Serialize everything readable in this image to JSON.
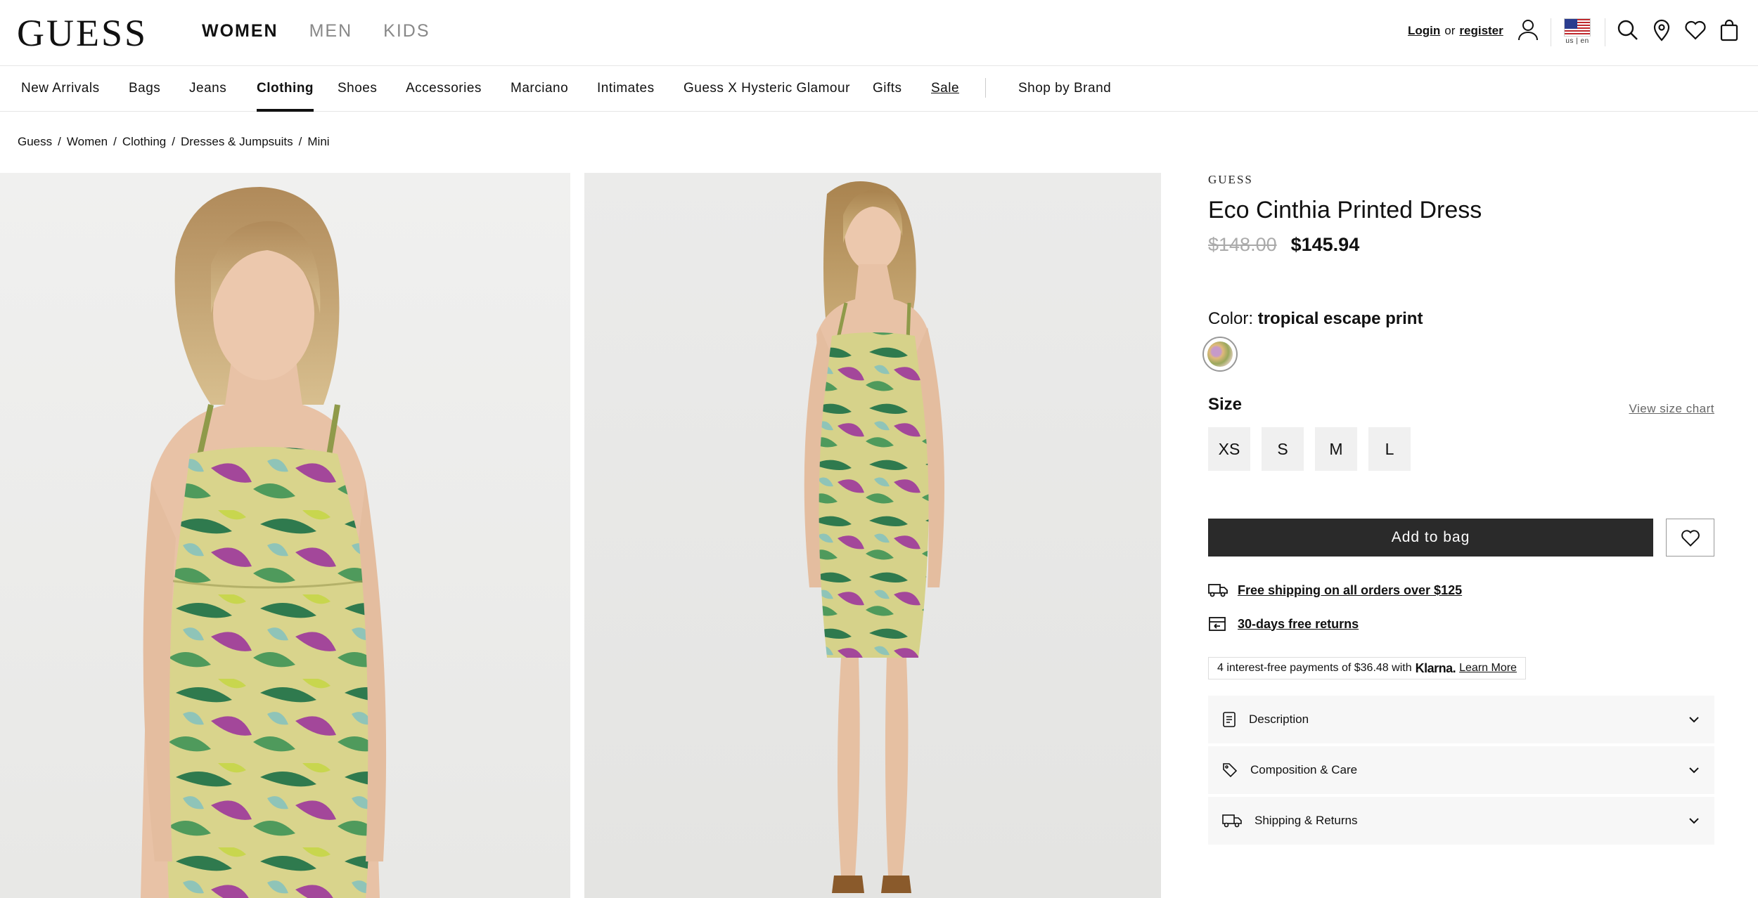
{
  "header": {
    "logo": "GUESS",
    "gender_tabs": [
      {
        "label": "WOMEN",
        "active": true
      },
      {
        "label": "MEN",
        "active": false
      },
      {
        "label": "KIDS",
        "active": false
      }
    ],
    "login_label": "Login",
    "or_label": "or",
    "register_label": "register",
    "locale_label": "us | en"
  },
  "categories": [
    {
      "label": "New Arrivals"
    },
    {
      "label": "Bags"
    },
    {
      "label": "Jeans"
    },
    {
      "label": "Clothing"
    },
    {
      "label": "Shoes"
    },
    {
      "label": "Accessories"
    },
    {
      "label": "Marciano"
    },
    {
      "label": "Intimates"
    },
    {
      "label": "Guess X Hysteric Glamour"
    },
    {
      "label": "Gifts"
    },
    {
      "label": "Sale"
    },
    {
      "label": "Shop by Brand"
    }
  ],
  "active_category": "Clothing",
  "breadcrumb": [
    "Guess",
    "Women",
    "Clothing",
    "Dresses & Jumpsuits",
    "Mini"
  ],
  "product": {
    "brand": "GUESS",
    "title": "Eco Cinthia Printed Dress",
    "original_price": "$148.00",
    "sale_price": "$145.94",
    "color_prefix": "Color:",
    "color_name": "tropical escape print",
    "size_label": "Size",
    "size_chart_label": "View size chart",
    "sizes": [
      "XS",
      "S",
      "M",
      "L"
    ],
    "add_to_bag_label": "Add to bag"
  },
  "perks": {
    "shipping": "Free shipping on all orders over $125",
    "returns": "30-days free returns"
  },
  "klarna": {
    "text": "4 interest-free payments of $36.48 with",
    "brand": "Klarna.",
    "learn_more": "Learn More"
  },
  "accordions": [
    {
      "label": "Description"
    },
    {
      "label": "Composition & Care"
    },
    {
      "label": "Shipping & Returns"
    }
  ],
  "colors": {
    "text": "#111111",
    "muted": "#888888",
    "button_dark": "#2a2a2a",
    "size_bg": "#f0f0f0"
  },
  "icons": [
    "user-icon",
    "flag-us-icon",
    "search-icon",
    "location-pin-icon",
    "heart-icon",
    "shopping-bag-icon",
    "truck-icon",
    "return-box-icon",
    "document-icon",
    "tag-icon",
    "delivery-truck-icon",
    "chevron-down-icon"
  ]
}
